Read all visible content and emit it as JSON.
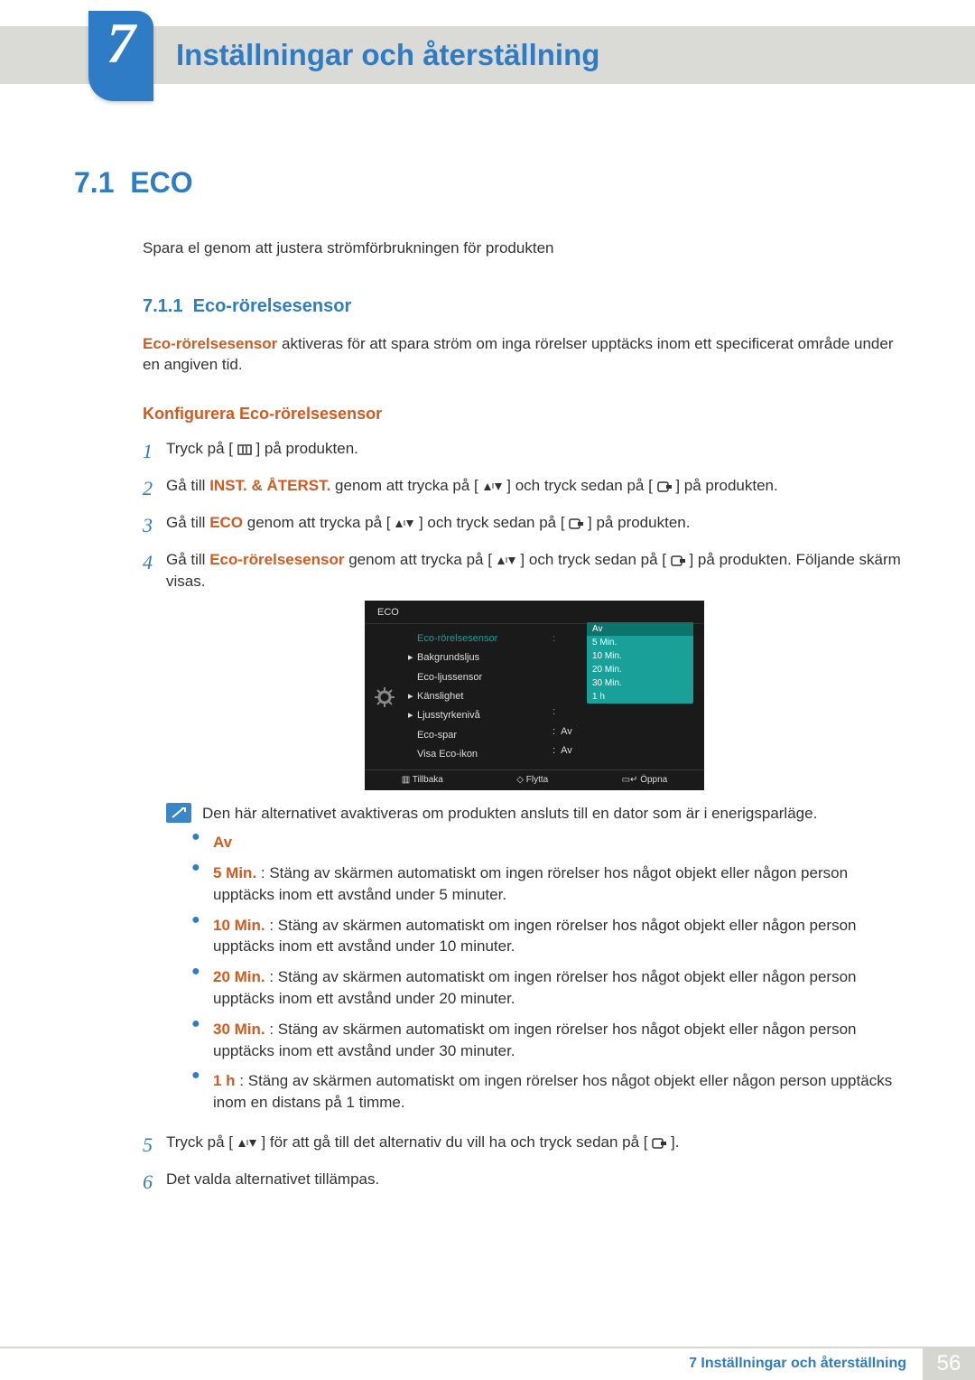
{
  "chapter": {
    "num": "7",
    "title": "Inställningar och återställning"
  },
  "sec": {
    "num": "7.1",
    "title": "ECO"
  },
  "intro": "Spara el genom att justera strömförbrukningen för produkten",
  "sub": {
    "num": "7.1.1",
    "title": "Eco-rörelsesensor"
  },
  "desc": {
    "bold": "Eco-rörelsesensor",
    "rest": " aktiveras för att spara ström om inga rörelser upptäcks inom ett specificerat område under en angiven tid."
  },
  "cfg_title": "Konfigurera Eco-rörelsesensor",
  "steps": {
    "s1": "Tryck på [ ",
    "s1b": " ] på produkten.",
    "s2a": "Gå till ",
    "s2menu": "INST. & ÅTERST.",
    "s2b": " genom att trycka på [",
    "s2c": "] och tryck sedan på [",
    "s2d": "] på produkten.",
    "s3a": "Gå till ",
    "s3menu": "ECO",
    "s3b": " genom att trycka på [",
    "s3c": "] och tryck sedan på [",
    "s3d": "] på produkten.",
    "s4a": "Gå till ",
    "s4menu": "Eco-rörelsesensor",
    "s4b": " genom att trycka på [",
    "s4c": "] och tryck sedan på [",
    "s4d": "] på produkten. Följande skärm visas.",
    "s5a": "Tryck på [",
    "s5b": "] för att gå till det alternativ du vill ha och tryck sedan på [",
    "s5c": "].",
    "s6": "Det valda alternativet tillämpas."
  },
  "note": "Den här alternativet avaktiveras om produkten ansluts till en dator som är i enerigsparläge.",
  "bullets": {
    "av": "Av",
    "b5": "5 Min.",
    "b5t": " : Stäng av skärmen automatiskt om ingen rörelser hos något objekt eller någon person upptäcks inom ett avstånd under 5 minuter.",
    "b10": "10 Min.",
    "b10t": " : Stäng av skärmen automatiskt om ingen rörelser hos något objekt eller någon person upptäcks inom ett avstånd under 10 minuter.",
    "b20": "20 Min.",
    "b20t": " : Stäng av skärmen automatiskt om ingen rörelser hos något objekt eller någon person upptäcks inom ett avstånd under 20 minuter.",
    "b30": "30 Min.",
    "b30t": " : Stäng av skärmen automatiskt om ingen rörelser hos något objekt eller någon person upptäcks inom ett avstånd under 30 minuter.",
    "b1h": "1 h",
    "b1ht": " : Stäng av skärmen automatiskt om ingen rörelser hos något objekt eller någon person upptäcks inom en distans på 1 timme."
  },
  "menu": {
    "title": "ECO",
    "items": [
      "Eco-rörelsesensor",
      "Bakgrundsljus",
      "Eco-ljussensor",
      "Känslighet",
      "Ljusstyrkenivå",
      "Eco-spar",
      "Visa Eco-ikon"
    ],
    "drop": [
      "Av",
      "5 Min.",
      "10 Min.",
      "20 Min.",
      "30 Min.",
      "1 h"
    ],
    "val_ecospar": "Av",
    "val_ecoicon": "Av",
    "footer": {
      "back": "Tillbaka",
      "move": "Flytta",
      "open": "Öppna"
    }
  },
  "footer": {
    "text": "7 Inställningar och återställning",
    "page": "56"
  }
}
